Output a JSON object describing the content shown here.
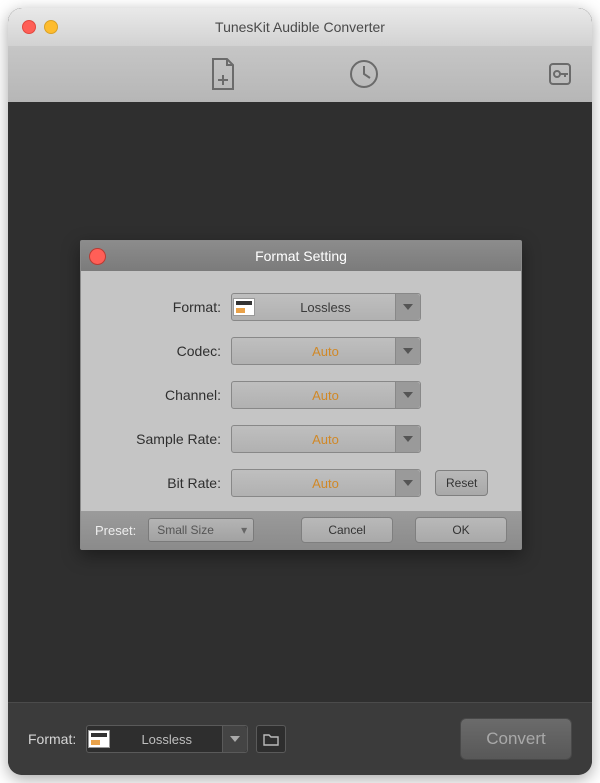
{
  "app": {
    "title": "TunesKit Audible Converter"
  },
  "modal": {
    "title": "Format Setting",
    "rows": {
      "format": {
        "label": "Format:",
        "value": "Lossless"
      },
      "codec": {
        "label": "Codec:",
        "value": "Auto"
      },
      "channel": {
        "label": "Channel:",
        "value": "Auto"
      },
      "samplerate": {
        "label": "Sample Rate:",
        "value": "Auto"
      },
      "bitrate": {
        "label": "Bit Rate:",
        "value": "Auto"
      }
    },
    "reset_label": "Reset",
    "preset_label": "Preset:",
    "preset_value": "Small Size",
    "cancel_label": "Cancel",
    "ok_label": "OK"
  },
  "bottom": {
    "format_label": "Format:",
    "format_value": "Lossless",
    "convert_label": "Convert"
  }
}
